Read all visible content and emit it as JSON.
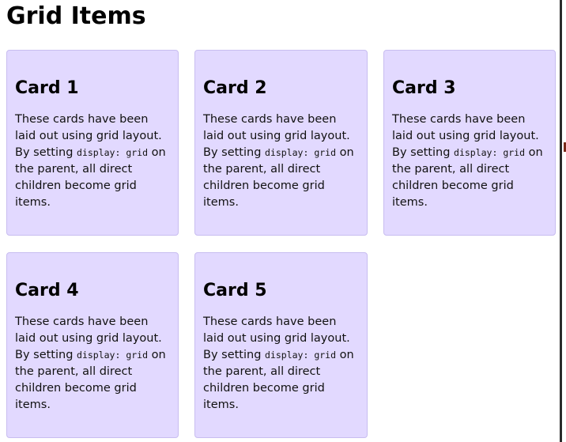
{
  "page": {
    "title": "Grid Items"
  },
  "cards": [
    {
      "title": "Card 1",
      "text_before_code": "These cards have been laid out using grid layout. By setting ",
      "code": "display: grid",
      "text_after_code": " on the parent, all direct children become grid items."
    },
    {
      "title": "Card 2",
      "text_before_code": "These cards have been laid out using grid layout. By setting ",
      "code": "display: grid",
      "text_after_code": " on the parent, all direct children become grid items."
    },
    {
      "title": "Card 3",
      "text_before_code": "These cards have been laid out using grid layout. By setting ",
      "code": "display: grid",
      "text_after_code": " on the parent, all direct children become grid items."
    },
    {
      "title": "Card 4",
      "text_before_code": "These cards have been laid out using grid layout. By setting ",
      "code": "display: grid",
      "text_after_code": " on the parent, all direct children become grid items."
    },
    {
      "title": "Card 5",
      "text_before_code": "These cards have been laid out using grid layout. By setting ",
      "code": "display: grid",
      "text_after_code": " on the parent, all direct children become grid items."
    }
  ],
  "colors": {
    "card_background": "#e2d9ff",
    "card_border": "#c8bdf0"
  }
}
